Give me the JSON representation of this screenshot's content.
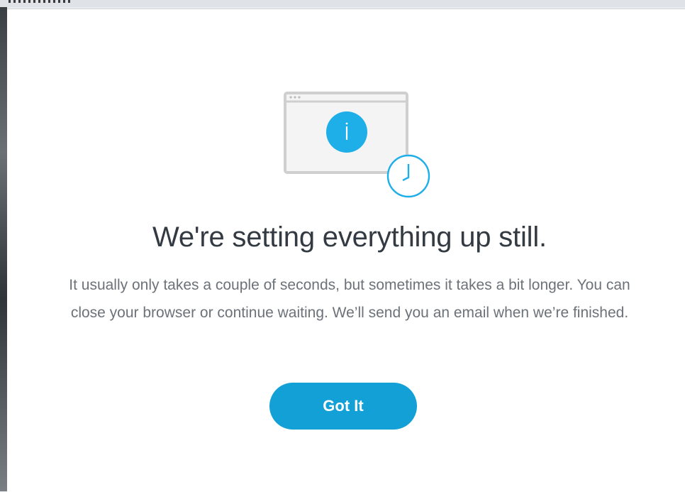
{
  "dialog": {
    "title": "We're setting everything up still.",
    "message": "It usually only takes a couple of seconds, but sometimes it takes a bit longer. You can close your browser or continue waiting. We’ll send you an email when we’re finished.",
    "button_label": "Got It"
  },
  "icons": {
    "illustration": "browser-window-icon",
    "info": "info-icon",
    "clock": "clock-icon"
  },
  "colors": {
    "accent": "#12a0d6",
    "title_text": "#333a41",
    "body_text": "#6c7278",
    "window_fill": "#f3f3f3",
    "window_border": "#cdcdcd"
  }
}
